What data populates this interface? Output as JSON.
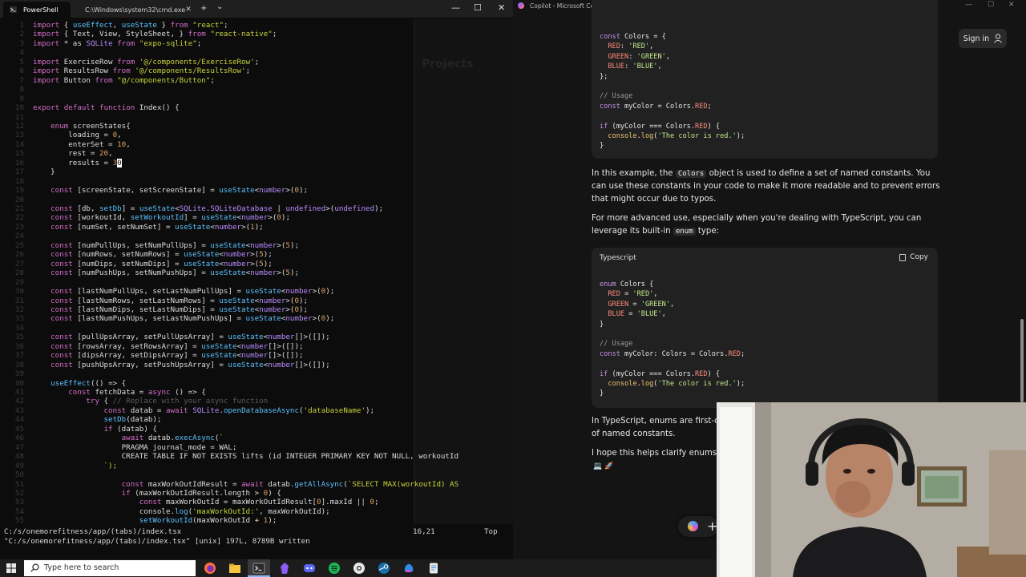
{
  "terminal": {
    "tabs": [
      {
        "label": "PowerShell",
        "active": true
      },
      {
        "label": "C:\\Windows\\system32\\cmd.exe",
        "active": false
      }
    ],
    "tab_add": "+",
    "tab_dropdown": "⌄",
    "window_controls": {
      "minimize": "—",
      "maximize": "☐",
      "close": "✕"
    },
    "code_lines": [
      "import { useEffect, useState } from \"react\";",
      "import { Text, View, StyleSheet, } from \"react-native\";",
      "import * as SQLite from \"expo-sqlite\";",
      "",
      "import ExerciseRow from '@/components/ExerciseRow';",
      "import ResultsRow from '@/components/ResultsRow';",
      "import Button from \"@/components/Button\";",
      "",
      "",
      "export default function Index() {",
      "",
      "    enum screenStates{",
      "        loading = 0,",
      "        enterSet = 10,",
      "        rest = 20,",
      "        results = 30",
      "    }",
      "",
      "    const [screenState, setScreenState] = useState<number>(0);",
      "",
      "    const [db, setDb] = useState<SQLite.SQLiteDatabase | undefined>(undefined);",
      "    const [workoutId, setWorkoutId] = useState<number>(0);",
      "    const [numSet, setNumSet] = useState<number>(1);",
      "",
      "    const [numPullUps, setNumPullUps] = useState<number>(5);",
      "    const [numRows, setNumRows] = useState<number>(5);",
      "    const [numDips, setNumDips] = useState<number>(5);",
      "    const [numPushUps, setNumPushUps] = useState<number>(5);",
      "",
      "    const [lastNumPullUps, setLastNumPullUps] = useState<number>(0);",
      "    const [lastNumRows, setLastNumRows] = useState<number>(0);",
      "    const [lastNumDips, setLastNumDips] = useState<number>(0);",
      "    const [lastNumPushUps, setLastNumPushUps] = useState<number>(0);",
      "",
      "    const [pullUpsArray, setPullUpsArray] = useState<number[]>([]);",
      "    const [rowsArray, setRowsArray] = useState<number[]>([]);",
      "    const [dipsArray, setDipsArray] = useState<number[]>([]);",
      "    const [pushUpsArray, setPushUpsArray] = useState<number[]>([]);",
      "",
      "    useEffect(() => {",
      "        const fetchData = async () => {",
      "            try { // Replace with your async function",
      "                const datab = await SQLite.openDatabaseAsync('databaseName');",
      "                setDb(datab);",
      "                if (datab) {",
      "                    await datab.execAsync(`",
      "                    PRAGMA journal_mode = WAL;",
      "                    CREATE TABLE IF NOT EXISTS lifts (id INTEGER PRIMARY KEY NOT NULL, workoutId",
      "                `);",
      "",
      "                    const maxWorkOutIdResult = await datab.getAllAsync(`SELECT MAX(workoutId) AS",
      "                    if (maxWorkOutIdResult.length > 0) {",
      "                        const maxWorkOutId = maxWorkOutIdResult[0].maxId || 0;",
      "                        console.log('maxWorkOutId:', maxWorkOutId);",
      "                        setWorkoutId(maxWorkOutId + 1);",
      "                    }"
    ],
    "status_line": {
      "path": "C:/s/onemorefitness/app/(tabs)/index.tsx",
      "position": "16,21",
      "scroll": "Top"
    },
    "message_line": "\"C:/s/onemorefitness/app/(tabs)/index.tsx\" [unix] 197L, 8789B written",
    "ghost_panel_title": "Projects"
  },
  "copilot": {
    "window_title": "Copilot - Microsoft Copilot: Your AI companion",
    "sign_in": "Sign in",
    "code_block_1": [
      "const Colors = {",
      "  RED: 'RED',",
      "  GREEN: 'GREEN',",
      "  BLUE: 'BLUE',",
      "};",
      "",
      "// Usage",
      "const myColor = Colors.RED;",
      "",
      "if (myColor === Colors.RED) {",
      "  console.log('The color is red.');",
      "}"
    ],
    "para_1_pre": "In this example, the ",
    "para_1_code": "Colors",
    "para_1_post": " object is used to define a set of named constants. You can use these constants in your code to make it more readable and to prevent errors that might occur due to typos.",
    "para_2_pre": "For more advanced use, especially when you're dealing with TypeScript, you can leverage its built-in ",
    "para_2_code": "enum",
    "para_2_post": " type:",
    "code_block_2_lang": "Typescript",
    "code_block_2_copy": "Copy",
    "code_block_2": [
      "enum Colors {",
      "  RED = 'RED',",
      "  GREEN = 'GREEN',",
      "  BLUE = 'BLUE',",
      "}",
      "",
      "// Usage",
      "const myColor: Colors = Colors.RED;",
      "",
      "if (myColor === Colors.RED) {",
      "  console.log('The color is red.');",
      "}"
    ],
    "para_3": "In TypeScript, enums are first-cla",
    "para_3b": "of named constants.",
    "para_4": "I hope this helps clarify enums fo",
    "fab_plus": "+"
  },
  "taskbar": {
    "search_placeholder": "Type here to search",
    "apps": [
      "firefox-icon",
      "file-explorer-icon",
      "terminal-icon",
      "obsidian-icon",
      "discord-icon",
      "spotify-icon",
      "steam-icon",
      "chrome-icon",
      "copilot-icon",
      "notepad-icon"
    ]
  },
  "colors": {
    "terminal_bg": "#0c0c0c",
    "copilot_bg": "#141414",
    "keyword": "#d36ec8",
    "string": "#c7d43c",
    "function": "#5cc1ff"
  }
}
